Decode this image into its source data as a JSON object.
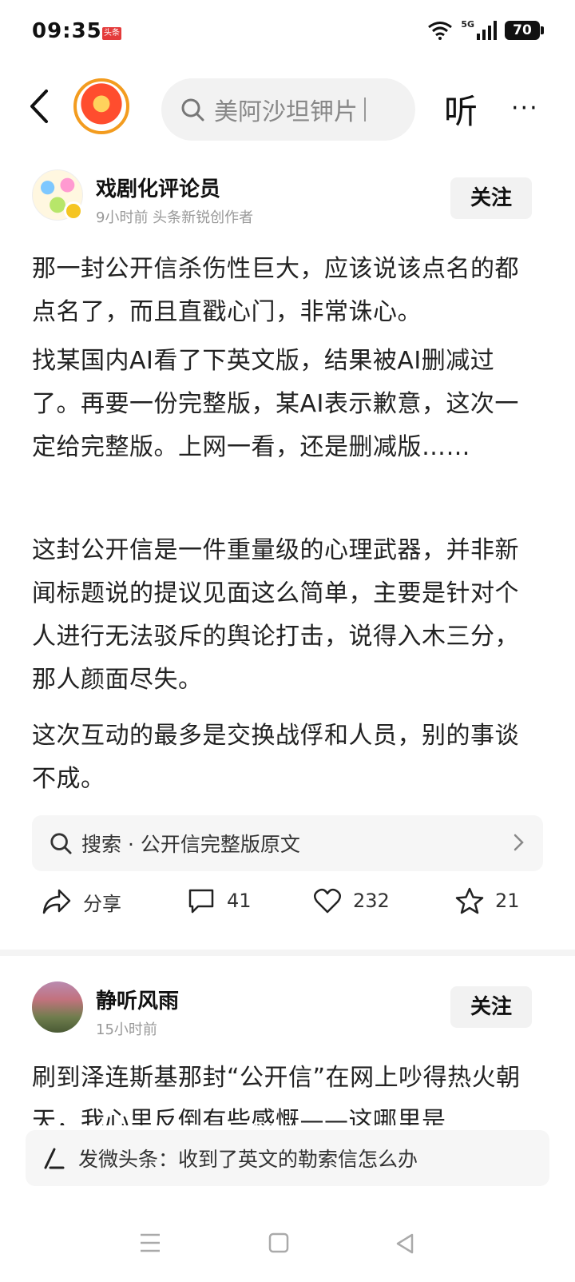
{
  "status_bar": {
    "time": "09:35",
    "app_badge": "头条",
    "network": "5G",
    "battery": "70"
  },
  "top_nav": {
    "search_placeholder": "美阿沙坦钾片",
    "listen_label": "听",
    "more_label": "···"
  },
  "post1": {
    "author": "戏剧化评论员",
    "meta": "9小时前  头条新锐创作者",
    "follow_label": "关注",
    "paragraphs": [
      "那一封公开信杀伤性巨大，应该说该点名的都点名了，而且直戳心门，非常诛心。",
      "找某国内AI看了下英文版，结果被AI删减过了。再要一份完整版，某AI表示歉意，这次一定给完整版。上网一看，还是删减版……",
      "这封公开信是一件重量级的心理武器，并非新闻标题说的提议见面这么简单，主要是针对个人进行无法驳斥的舆论打击，说得入木三分，那人颜面尽失。",
      "这次互动的最多是交换战俘和人员，别的事谈不成。"
    ],
    "search_suggestion": "搜索 · 公开信完整版原文",
    "actions": {
      "share": "分享",
      "comments": "41",
      "likes": "232",
      "favorites": "21"
    }
  },
  "post2": {
    "author": "静听风雨",
    "meta": "15小时前",
    "follow_label": "关注",
    "paragraph": "刷到泽连斯基那封“公开信”在网上吵得热火朝天，我心里反倒有些感慨——这哪里是"
  },
  "comment_bar": {
    "placeholder": "发微头条：收到了英文的勒索信怎么办"
  }
}
